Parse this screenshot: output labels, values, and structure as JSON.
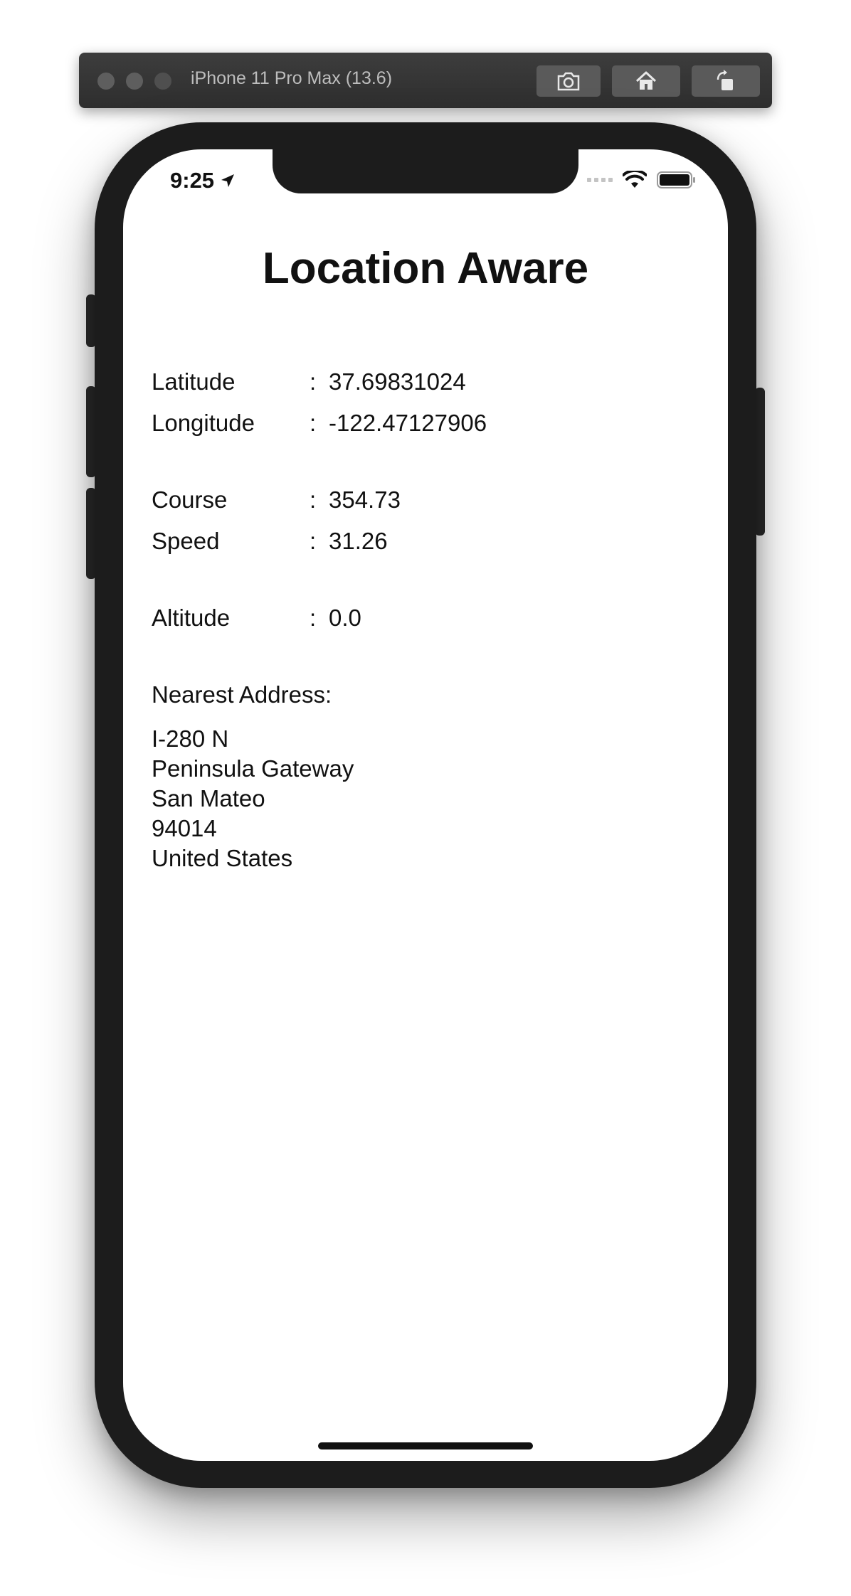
{
  "simulator": {
    "title": "iPhone 11 Pro Max (13.6)",
    "buttons": {
      "screenshot_icon": "camera-icon",
      "home_icon": "home-icon",
      "rotate_icon": "rotate-icon"
    }
  },
  "status_bar": {
    "time": "9:25",
    "location_icon": "location-arrow-icon",
    "wifi_icon": "wifi-icon",
    "battery_icon": "battery-icon"
  },
  "app": {
    "title": "Location Aware",
    "fields": [
      {
        "label": "Latitude",
        "separator": ":",
        "value": "37.69831024"
      },
      {
        "label": "Longitude",
        "separator": ":",
        "value": "-122.47127906"
      },
      {
        "label": "Course",
        "separator": ":",
        "value": "354.73"
      },
      {
        "label": "Speed",
        "separator": ":",
        "value": "31.26"
      },
      {
        "label": "Altitude",
        "separator": ":",
        "value": "0.0"
      }
    ],
    "nearest_address_label": "Nearest Address:",
    "address_lines": [
      "I-280 N",
      "Peninsula Gateway",
      "San Mateo",
      "94014",
      "United States"
    ]
  }
}
